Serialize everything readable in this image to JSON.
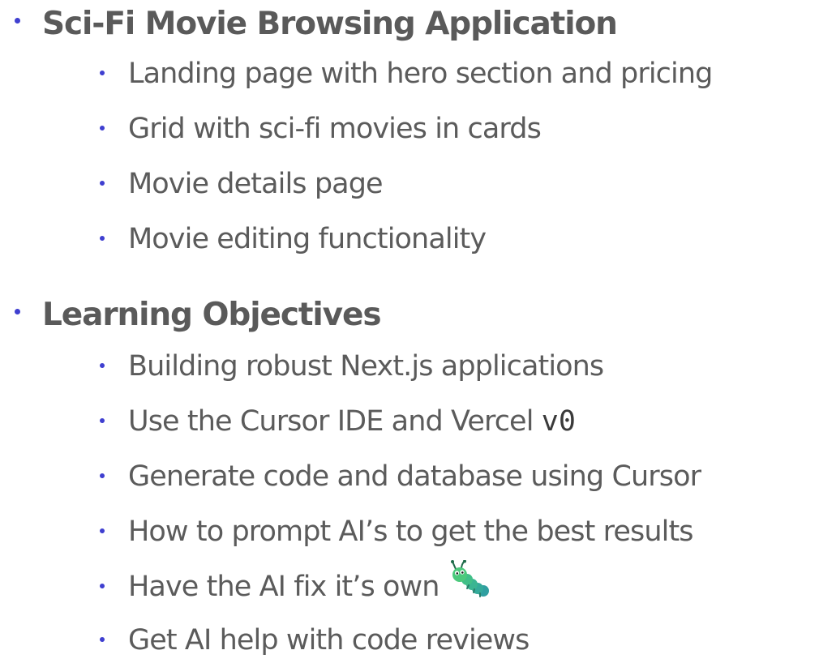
{
  "sections": [
    {
      "heading": "Sci-Fi Movie Browsing Application",
      "items": [
        "Landing page with hero section and pricing",
        "Grid with sci-fi movies in cards",
        "Movie details page",
        "Movie editing functionality"
      ]
    },
    {
      "heading": "Learning Objectives",
      "items": [
        "Building robust Next.js applications",
        "Use the Cursor IDE and Vercel ",
        "Generate code and database using Cursor",
        "How to prompt AI’s to get the best results",
        "Have the AI fix it’s own",
        "Get AI help with code reviews"
      ],
      "item_2_code": "v0",
      "item_5_icon": "bug-emoji-icon"
    }
  ],
  "colors": {
    "bullet": "#3f3fd0",
    "text": "#595959",
    "bug_green": "#3fbf8a"
  }
}
